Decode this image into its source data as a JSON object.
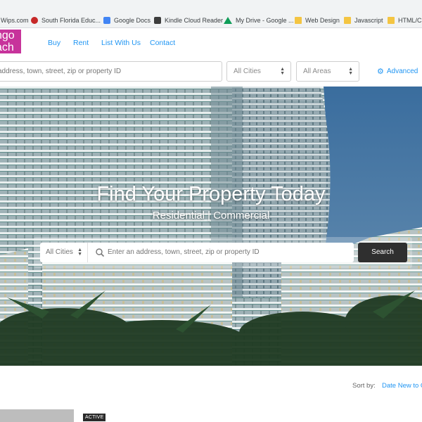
{
  "bookmarks": [
    {
      "label": "Wips.com",
      "icon": "none"
    },
    {
      "label": "South Florida Educ...",
      "icon": "apple-icon"
    },
    {
      "label": "Google Docs",
      "icon": "docs-icon"
    },
    {
      "label": "Kindle Cloud Reader",
      "icon": "kindle-icon"
    },
    {
      "label": "My Drive - Google ...",
      "icon": "drive-icon"
    },
    {
      "label": "Web Design",
      "icon": "folder-icon"
    },
    {
      "label": "Javascript",
      "icon": "folder-icon"
    },
    {
      "label": "HTML/CSS",
      "icon": "folder-icon"
    }
  ],
  "header": {
    "logo_line1": "ngo",
    "logo_line2": "ach",
    "logo_color": "#c7339b",
    "nav": [
      "Buy",
      "Rent",
      "List With Us",
      "Contact"
    ]
  },
  "top_search": {
    "placeholder": "address, town, street, zip or property ID",
    "cities": "All Cities",
    "areas": "All Areas",
    "advanced": "Advanced"
  },
  "hero": {
    "title": "Find Your Property Today",
    "subtitle": "Residential | Commercial",
    "cities": "All Cities",
    "placeholder": "Enter an address, town, street, zip or property ID",
    "button": "Search"
  },
  "results": {
    "sort_label": "Sort by:",
    "sort_value": "Date New to O",
    "status_badge": "ACTIVE"
  },
  "colors": {
    "accent": "#2196f3",
    "button": "#2f2f2f"
  }
}
